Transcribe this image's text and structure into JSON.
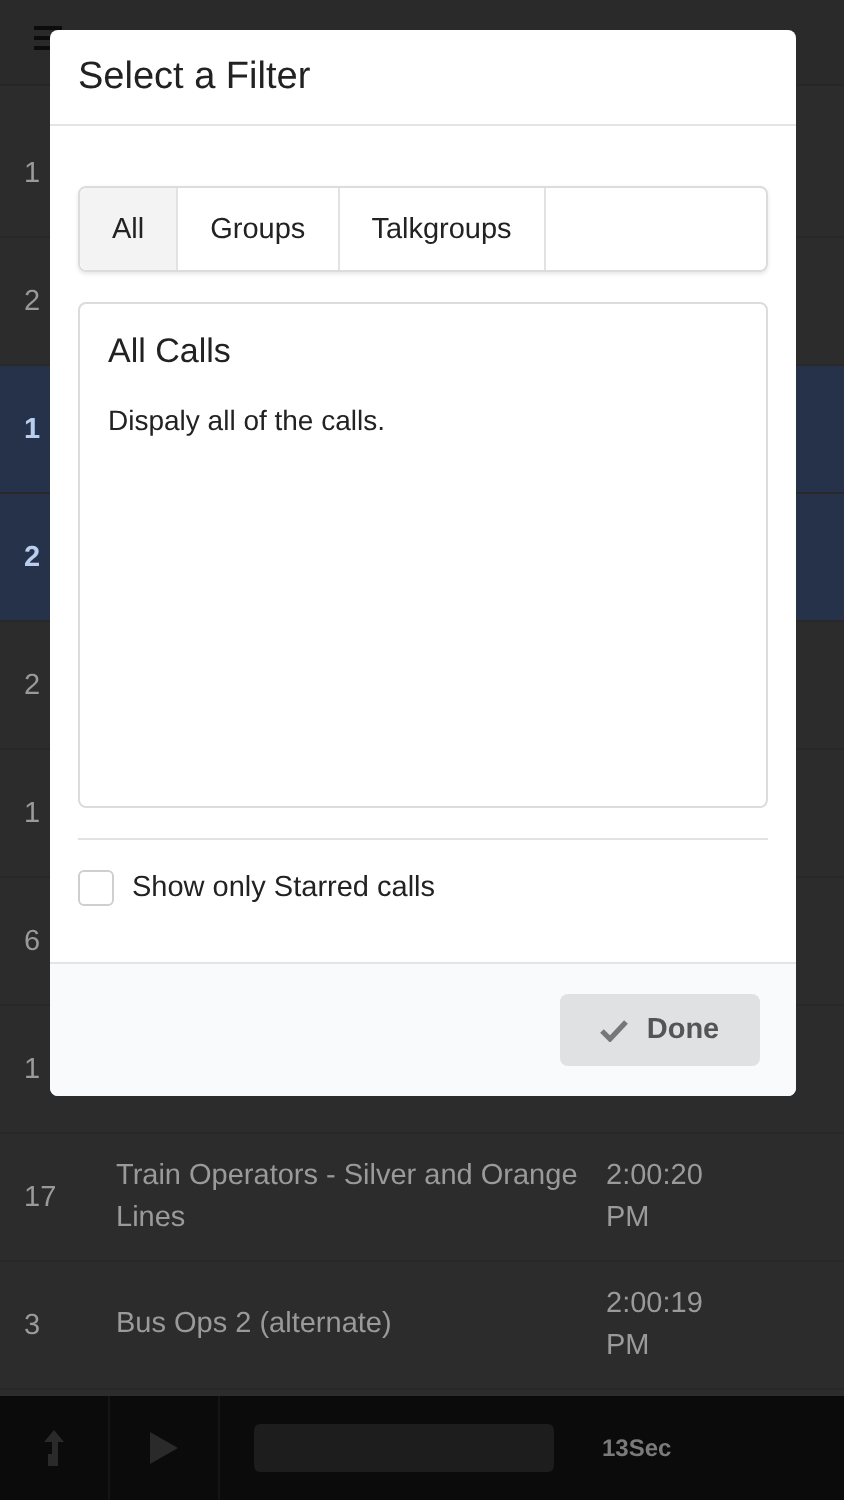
{
  "calls": [
    {
      "count": "1",
      "selected": false
    },
    {
      "count": "2",
      "selected": false
    },
    {
      "count": "1",
      "selected": true
    },
    {
      "count": "2",
      "selected": true
    },
    {
      "count": "2",
      "selected": false
    },
    {
      "count": "1",
      "selected": false
    },
    {
      "count": "6",
      "selected": false
    },
    {
      "count": "1",
      "selected": false
    },
    {
      "count": "17",
      "name": "Train Operators - Silver and Orange Lines",
      "time": "2:00:20 PM",
      "selected": false
    },
    {
      "count": "3",
      "name": "Bus Ops 2 (alternate)",
      "time": "2:00:19 PM",
      "selected": false
    }
  ],
  "player": {
    "level": 0,
    "duration": "13Sec"
  },
  "dialog": {
    "title": "Select a Filter",
    "tabs": [
      {
        "label": "All",
        "selected": true
      },
      {
        "label": "Groups",
        "selected": false
      },
      {
        "label": "Talkgroups",
        "selected": false
      }
    ],
    "panel": {
      "heading": "All Calls",
      "description": "Dispaly all of the calls."
    },
    "starred_only": {
      "label": "Show only Starred calls",
      "checked": false
    },
    "done_button": "Done"
  }
}
